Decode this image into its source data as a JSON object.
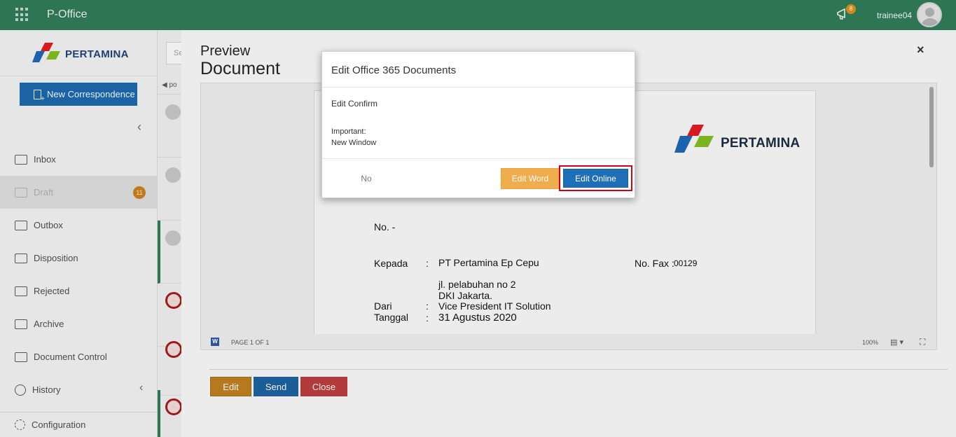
{
  "topbar": {
    "app_title": "P-Office",
    "notification_count": "8",
    "username": "trainee04"
  },
  "sidebar": {
    "logo_text": "PERTAMINA",
    "new_correspondence": "New Correspondence",
    "items": [
      {
        "label": "Inbox"
      },
      {
        "label": "Draft",
        "badge": "11"
      },
      {
        "label": "Outbox"
      },
      {
        "label": "Disposition"
      },
      {
        "label": "Rejected"
      },
      {
        "label": "Archive"
      },
      {
        "label": "Document Control"
      },
      {
        "label": "History"
      },
      {
        "label": "Configuration"
      }
    ]
  },
  "list": {
    "search_placeholder": "Se",
    "nav_text": "po"
  },
  "preview": {
    "title_line1": "Preview",
    "title_line2": "Document",
    "close_glyph": "×",
    "document": {
      "logo_text": "PERTAMINA",
      "no_label": "No. -",
      "kepada_label": "Kepada",
      "kepada_colon": ":",
      "kepada_value": "PT Pertamina Ep Cepu",
      "fax_label": "No. Fax :",
      "fax_value": "00129",
      "address_line1": "jl. pelabuhan no 2",
      "address_line2": "DKI Jakarta.",
      "dari_label": "Dari",
      "dari_colon": ":",
      "dari_value": "Vice President IT Solution",
      "tanggal_label": "Tanggal",
      "tanggal_colon": ":",
      "tanggal_value": "31 Agustus 2020"
    },
    "viewer_footer": {
      "page_indicator": "PAGE 1 OF 1",
      "zoom": "100%"
    },
    "buttons": {
      "edit": "Edit",
      "send": "Send",
      "close": "Close"
    }
  },
  "modal": {
    "title": "Edit Office 365 Documents",
    "confirm_text": "Edit Confirm",
    "important_label": "Important:",
    "important_value": "New Window",
    "no_button": "No",
    "edit_word_button": "Edit Word",
    "edit_online_button": "Edit Online"
  },
  "colors": {
    "topbar": "#2e7553",
    "primary_button": "#1f6fb8",
    "warning_button": "#f0ad4e",
    "danger_button": "#b23a3a",
    "highlight_border": "#d0021b"
  }
}
